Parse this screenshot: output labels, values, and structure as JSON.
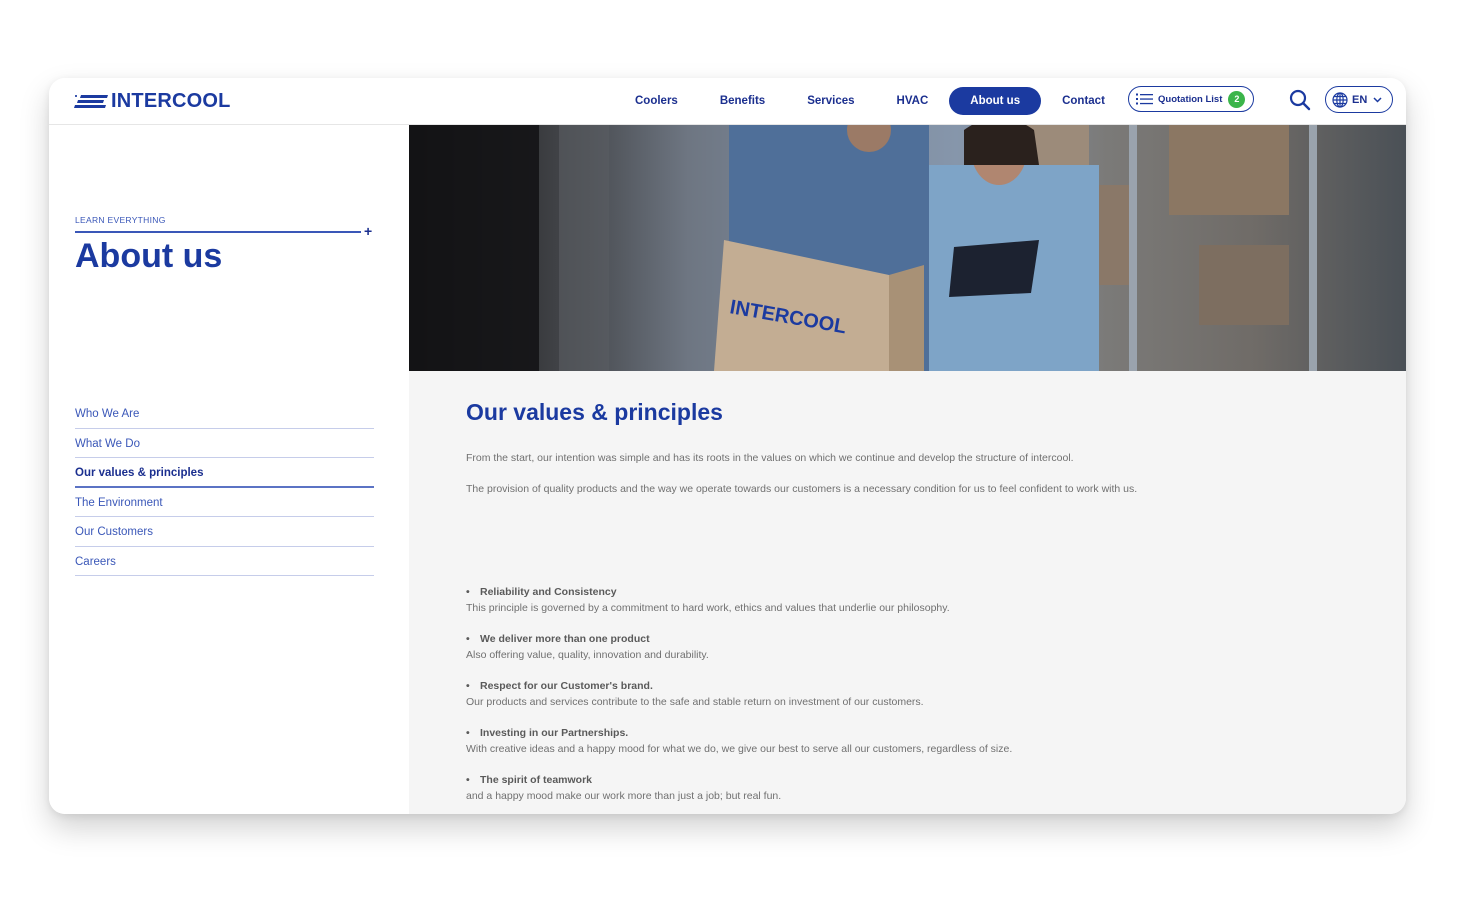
{
  "brand": {
    "name": "INTERCOOL",
    "color": "#1b3aa0",
    "accent_green": "#3bb54a"
  },
  "header": {
    "nav": [
      {
        "label": "Coolers",
        "active": false
      },
      {
        "label": "Benefits",
        "active": false
      },
      {
        "label": "Services",
        "active": false
      },
      {
        "label": "HVAC",
        "active": false
      },
      {
        "label": "About us",
        "active": true
      },
      {
        "label": "Contact",
        "active": false
      }
    ],
    "quotation": {
      "icon": "list-icon",
      "label": "Quotation List",
      "count": "2"
    },
    "search_icon": "search-icon",
    "language": {
      "icon": "globe-icon",
      "label": "EN",
      "chevron": "chevron-down-icon"
    }
  },
  "sidebar": {
    "eyebrow": "LEARN EVERYTHING",
    "plus": "+",
    "title": "About us",
    "items": [
      {
        "label": "Who We Are",
        "active": false
      },
      {
        "label": "What We Do",
        "active": false
      },
      {
        "label": "Our values & principles",
        "active": true
      },
      {
        "label": "The Environment",
        "active": false
      },
      {
        "label": "Our Customers",
        "active": false
      },
      {
        "label": "Careers",
        "active": false
      }
    ]
  },
  "hero": {
    "alt": "Two people in a warehouse holding an INTERCOOL box and a tablet",
    "box_logo": "INTERCOOL"
  },
  "main": {
    "title": "Our values & principles",
    "intro": [
      "From the start, our intention was simple and has its roots in the values on which we continue and develop the structure of intercool.",
      "The provision of quality products and the way we operate towards our customers is a necessary condition for us to feel confident to work with us."
    ],
    "principles": [
      {
        "title": "Reliability and Consistency",
        "desc": "This principle is governed by a commitment to hard work, ethics and values that underlie our philosophy."
      },
      {
        "title": "We deliver more than one product",
        "desc": "Also offering value, quality, innovation and durability."
      },
      {
        "title": "Respect for our Customer's brand.",
        "desc": "Our products and services contribute to the safe and stable return on investment of our customers."
      },
      {
        "title": "Investing in our Partnerships.",
        "desc": "With creative ideas and a happy mood for what we do, we give our best to serve all our customers, regardless of size."
      },
      {
        "title": "The spirit of teamwork",
        "desc": "and a happy mood make our work more than just a job; but real fun."
      }
    ]
  }
}
